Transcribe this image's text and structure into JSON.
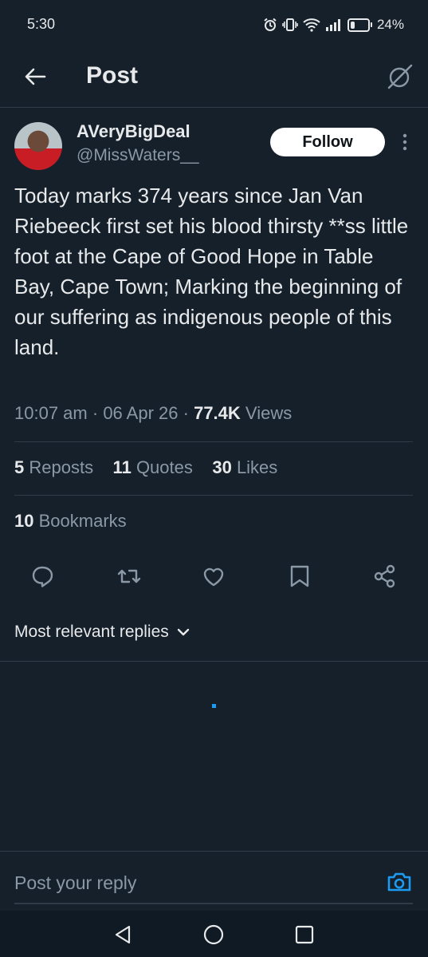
{
  "status_bar": {
    "time": "5:30",
    "battery": "24%",
    "battery_level": 0.24
  },
  "header": {
    "title": "Post"
  },
  "author": {
    "display_name": "AVeryBigDeal",
    "handle": "@MissWaters__",
    "follow_label": "Follow"
  },
  "tweet": {
    "text": "Today marks 374 years since Jan Van Riebeeck first set his blood thirsty **ss little foot at the Cape of Good Hope in Table Bay, Cape Town; Marking the beginning of our suffering as indigenous people of this land.",
    "time": "10:07 am",
    "date": "06 Apr 26",
    "views_count": "77.4K",
    "views_label": "Views",
    "separator": "·"
  },
  "stats": {
    "reposts_count": "5",
    "reposts_label": "Reposts",
    "quotes_count": "11",
    "quotes_label": "Quotes",
    "likes_count": "30",
    "likes_label": "Likes",
    "bookmarks_count": "10",
    "bookmarks_label": "Bookmarks"
  },
  "actions": [
    "reply-icon",
    "repost-icon",
    "like-icon",
    "bookmark-icon",
    "share-icon"
  ],
  "replies": {
    "sort_label": "Most relevant replies"
  },
  "reply_box": {
    "placeholder": "Post your reply"
  },
  "colors": {
    "background": "#15202b",
    "accent": "#1d9bf0",
    "muted": "#8b98a5",
    "text": "#e7e9ea"
  }
}
